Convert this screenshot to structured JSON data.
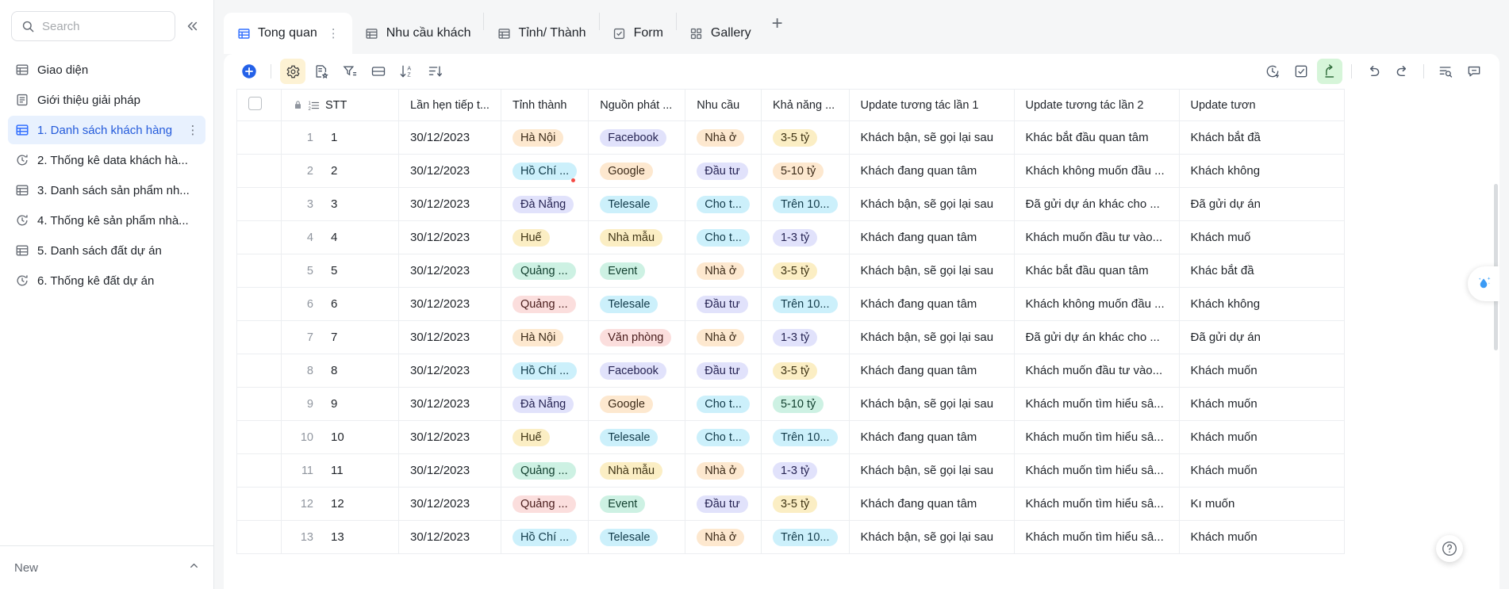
{
  "sidebar": {
    "search": {
      "placeholder": "Search",
      "icon": "search-icon"
    },
    "collapse_label": "«",
    "items": [
      {
        "label": "Giao diện",
        "icon": "grid-table-icon",
        "active": false
      },
      {
        "label": "Giới thiệu giải pháp",
        "icon": "document-icon",
        "active": false
      },
      {
        "label": "1. Danh sách khách hàng",
        "icon": "grid-table-icon",
        "active": true
      },
      {
        "label": "2. Thống kê data khách hà...",
        "icon": "dashboard-clock-icon",
        "active": false
      },
      {
        "label": "3. Danh sách sản phẩm nh...",
        "icon": "grid-table-icon",
        "active": false
      },
      {
        "label": "4. Thống kê sản phẩm nhà...",
        "icon": "dashboard-clock-icon",
        "active": false
      },
      {
        "label": "5. Danh sách đất dự án",
        "icon": "grid-table-icon",
        "active": false
      },
      {
        "label": "6. Thống kê đất dự án",
        "icon": "dashboard-clock-icon",
        "active": false
      }
    ],
    "more_dots": "⋮",
    "footer": {
      "label": "New",
      "caret": "chevron-up-icon"
    }
  },
  "tabs": {
    "items": [
      {
        "label": "Tong quan",
        "icon": "table-icon",
        "active": true,
        "dots": "⋮"
      },
      {
        "label": "Nhu cầu khách",
        "icon": "table-icon",
        "active": false
      },
      {
        "label": "Tỉnh/ Thành",
        "icon": "table-icon",
        "active": false
      },
      {
        "label": "Form",
        "icon": "form-check-icon",
        "active": false
      },
      {
        "label": "Gallery",
        "icon": "gallery-grid-icon",
        "active": false
      }
    ],
    "add_label": "+"
  },
  "toolbar": {
    "left": [
      {
        "name": "add-record-button",
        "icon": "plus-circle-icon",
        "style": "plus"
      },
      {
        "name": "field-settings-button",
        "icon": "gear-icon",
        "style": "highlight-y"
      },
      {
        "name": "group-button",
        "icon": "doc-star-icon",
        "style": ""
      },
      {
        "name": "filter-button",
        "icon": "funnel-icon",
        "style": ""
      },
      {
        "name": "row-height-button",
        "icon": "list-rows-icon",
        "style": ""
      },
      {
        "name": "sort-button",
        "icon": "sort-az-icon",
        "style": ""
      },
      {
        "name": "group-sort-button",
        "icon": "sort-lines-icon",
        "style": ""
      }
    ],
    "right": [
      {
        "name": "history-button",
        "icon": "clock-history-icon",
        "style": ""
      },
      {
        "name": "form-view-button",
        "icon": "checkbox-square-icon",
        "style": ""
      },
      {
        "name": "share-button",
        "icon": "share-arrow-icon",
        "style": "highlight-g"
      },
      {
        "name": "undo-button",
        "icon": "undo-icon",
        "style": ""
      },
      {
        "name": "redo-button",
        "icon": "redo-icon",
        "style": ""
      },
      {
        "name": "search-records-button",
        "icon": "search-lines-icon",
        "style": ""
      },
      {
        "name": "comment-button",
        "icon": "comment-icon",
        "style": ""
      }
    ]
  },
  "table": {
    "headers": {
      "check": "",
      "stt": "STT",
      "date": "Lần hẹn tiếp t...",
      "province": "Tỉnh thành",
      "source": "Nguồn phát ...",
      "need": "Nhu cầu",
      "capacity": "Khả năng ...",
      "update1": "Update tương tác lần 1",
      "update2": "Update tương tác lần 2",
      "update3": "Update tươn"
    },
    "rows": [
      {
        "n": "1",
        "stt": "1",
        "date": "30/12/2023",
        "province": "Hà Nội",
        "province_color": "orange",
        "source": "Facebook",
        "source_color": "purple",
        "need": "Nhà ở",
        "need_color": "orange",
        "capacity": "3-5 tỷ",
        "capacity_color": "yellow",
        "u1": "Khách bận, sẽ gọi lại sau",
        "u2": "Khác bắt đầu quan tâm",
        "u3": "Khách bắt đầ"
      },
      {
        "n": "2",
        "stt": "2",
        "date": "30/12/2023",
        "province": "Hồ Chí ...",
        "province_color": "cyan",
        "province_dot": true,
        "source": "Google",
        "source_color": "orange",
        "need": "Đầu tư",
        "need_color": "purple",
        "capacity": "5-10 tỷ",
        "capacity_color": "orange",
        "u1": "Khách đang quan tâm",
        "u2": "Khách không muốn đầu ...",
        "u3": "Khách không"
      },
      {
        "n": "3",
        "stt": "3",
        "date": "30/12/2023",
        "province": "Đà Nẵng",
        "province_color": "purple",
        "source": "Telesale",
        "source_color": "cyan",
        "need": "Cho t...",
        "need_color": "cyan",
        "capacity": "Trên 10...",
        "capacity_color": "cyan",
        "u1": "Khách bận, sẽ gọi lại sau",
        "u2": "Đã gửi dự án khác cho ...",
        "u3": "Đã gửi dự án"
      },
      {
        "n": "4",
        "stt": "4",
        "date": "30/12/2023",
        "province": "Huế",
        "province_color": "yellow",
        "source": "Nhà mẫu",
        "source_color": "yellow",
        "need": "Cho t...",
        "need_color": "cyan",
        "capacity": "1-3 tỷ",
        "capacity_color": "purple",
        "u1": "Khách đang quan tâm",
        "u2": "Khách muốn đầu tư vào...",
        "u3": "Khách muố"
      },
      {
        "n": "5",
        "stt": "5",
        "date": "30/12/2023",
        "province": "Quảng ...",
        "province_color": "green",
        "source": "Event",
        "source_color": "green",
        "need": "Nhà ở",
        "need_color": "orange",
        "capacity": "3-5 tỷ",
        "capacity_color": "yellow",
        "u1": "Khách bận, sẽ gọi lại sau",
        "u2": "Khác bắt đầu quan tâm",
        "u3": "Khác bắt đầ"
      },
      {
        "n": "6",
        "stt": "6",
        "date": "30/12/2023",
        "province": "Quảng ...",
        "province_color": "pink",
        "source": "Telesale",
        "source_color": "cyan",
        "need": "Đầu tư",
        "need_color": "purple",
        "capacity": "Trên 10...",
        "capacity_color": "cyan",
        "u1": "Khách đang quan tâm",
        "u2": "Khách không muốn đầu ...",
        "u3": "Khách không"
      },
      {
        "n": "7",
        "stt": "7",
        "date": "30/12/2023",
        "province": "Hà Nội",
        "province_color": "orange",
        "source": "Văn phòng",
        "source_color": "pink",
        "need": "Nhà ở",
        "need_color": "orange",
        "capacity": "1-3 tỷ",
        "capacity_color": "purple",
        "u1": "Khách bận, sẽ gọi lại sau",
        "u2": "Đã gửi dự án khác cho ...",
        "u3": "Đã gửi dự án"
      },
      {
        "n": "8",
        "stt": "8",
        "date": "30/12/2023",
        "province": "Hồ Chí ...",
        "province_color": "cyan",
        "source": "Facebook",
        "source_color": "purple",
        "need": "Đầu tư",
        "need_color": "purple",
        "capacity": "3-5 tỷ",
        "capacity_color": "yellow",
        "u1": "Khách đang quan tâm",
        "u2": "Khách muốn đầu tư vào...",
        "u3": "Khách muốn"
      },
      {
        "n": "9",
        "stt": "9",
        "date": "30/12/2023",
        "province": "Đà Nẵng",
        "province_color": "purple",
        "source": "Google",
        "source_color": "orange",
        "need": "Cho t...",
        "need_color": "cyan",
        "capacity": "5-10 tỷ",
        "capacity_color": "green",
        "u1": "Khách bận, sẽ gọi lại sau",
        "u2": "Khách muốn tìm hiểu sâ...",
        "u3": "Khách muốn"
      },
      {
        "n": "10",
        "stt": "10",
        "date": "30/12/2023",
        "province": "Huế",
        "province_color": "yellow",
        "source": "Telesale",
        "source_color": "cyan",
        "need": "Cho t...",
        "need_color": "cyan",
        "capacity": "Trên 10...",
        "capacity_color": "cyan",
        "u1": "Khách đang quan tâm",
        "u2": "Khách muốn tìm hiểu sâ...",
        "u3": "Khách muốn"
      },
      {
        "n": "11",
        "stt": "11",
        "date": "30/12/2023",
        "province": "Quảng ...",
        "province_color": "green",
        "source": "Nhà mẫu",
        "source_color": "yellow",
        "need": "Nhà ở",
        "need_color": "orange",
        "capacity": "1-3 tỷ",
        "capacity_color": "purple",
        "u1": "Khách bận, sẽ gọi lại sau",
        "u2": "Khách muốn tìm hiểu sâ...",
        "u3": "Khách muốn"
      },
      {
        "n": "12",
        "stt": "12",
        "date": "30/12/2023",
        "province": "Quảng ...",
        "province_color": "pink",
        "source": "Event",
        "source_color": "green",
        "need": "Đầu tư",
        "need_color": "purple",
        "capacity": "3-5 tỷ",
        "capacity_color": "yellow",
        "u1": "Khách đang quan tâm",
        "u2": "Khách muốn tìm hiểu sâ...",
        "u3": "Kı muốn"
      },
      {
        "n": "13",
        "stt": "13",
        "date": "30/12/2023",
        "province": "Hồ Chí ...",
        "province_color": "cyan",
        "source": "Telesale",
        "source_color": "cyan",
        "need": "Nhà ở",
        "need_color": "orange",
        "capacity": "Trên 10...",
        "capacity_color": "cyan",
        "u1": "Khách bận, sẽ gọi lại sau",
        "u2": "Khách muốn tìm hiểu sâ...",
        "u3": "Khách muốn"
      }
    ]
  },
  "floating": {
    "ai_icon": "ai-sparkle-droplet-icon",
    "help_label": "?"
  },
  "colors": {
    "accent_blue": "#3370ff",
    "active_nav_bg": "#e8f1fe",
    "tag_orange_bg": "#fde8cf",
    "tag_purple_bg": "#e1e2fb",
    "tag_cyan_bg": "#ccf0fb",
    "tag_yellow_bg": "#fbeec4",
    "tag_green_bg": "#cdf1e3",
    "tag_pink_bg": "#fbdedd",
    "share_highlight": "#d6f5d9",
    "gear_highlight": "#fdf2d4",
    "red_dot": "#f54a45"
  }
}
